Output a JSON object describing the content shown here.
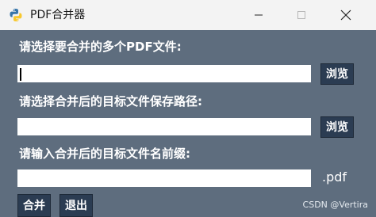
{
  "window": {
    "title": "PDF合并器",
    "app_icon": "python-icon",
    "controls": {
      "minimize_icon": "minimize-icon",
      "maximize_icon": "maximize-icon",
      "close_icon": "close-icon"
    }
  },
  "form": {
    "source_label": "请选择要合并的多个PDF文件:",
    "source_value": "",
    "source_browse": "浏览",
    "target_dir_label": "请选择合并后的目标文件保存路径:",
    "target_dir_value": "",
    "target_dir_browse": "浏览",
    "prefix_label": "请输入合并后的目标文件名前缀:",
    "prefix_value": "",
    "prefix_suffix": ".pdf"
  },
  "actions": {
    "merge": "合并",
    "exit": "退出"
  },
  "watermark": "CSDN @Vertira",
  "colors": {
    "window_bg": "#5e6d7e",
    "button_bg": "#2b3c52",
    "titlebar_bg": "#f3f3f3"
  }
}
